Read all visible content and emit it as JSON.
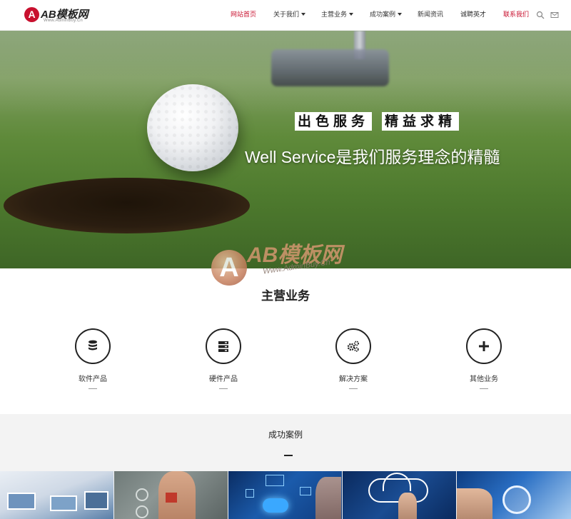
{
  "header": {
    "logo_text": "AB模板网",
    "logo_badge": "A",
    "logo_sub": "Www.AdminBuy.Cn",
    "nav": [
      {
        "label": "网站首页",
        "has_caret": false,
        "active": true
      },
      {
        "label": "关于我们",
        "has_caret": true,
        "active": false
      },
      {
        "label": "主营业务",
        "has_caret": true,
        "active": false
      },
      {
        "label": "成功案例",
        "has_caret": true,
        "active": false
      },
      {
        "label": "新闻资讯",
        "has_caret": false,
        "active": false
      },
      {
        "label": "诚聘英才",
        "has_caret": false,
        "active": false
      },
      {
        "label": "联系我们",
        "has_caret": false,
        "active": false
      }
    ],
    "icons": [
      "search-icon",
      "mail-icon"
    ]
  },
  "hero": {
    "tagline_1": "出色服务",
    "tagline_2": "精益求精",
    "subtitle": "Well Service是我们服务理念的精髓"
  },
  "watermark": {
    "badge": "A",
    "text": "AB模板网",
    "sub": "Www.AdminBuy.Cn"
  },
  "services": {
    "title": "主营业务",
    "items": [
      {
        "label": "软件产品",
        "icon": "database-icon"
      },
      {
        "label": "硬件产品",
        "icon": "server-icon"
      },
      {
        "label": "解决方案",
        "icon": "gears-icon"
      },
      {
        "label": "其他业务",
        "icon": "plus-icon"
      }
    ]
  },
  "cases": {
    "title": "成功案例"
  },
  "colors": {
    "accent": "#c8102e",
    "text": "#222222",
    "cases_bg": "#f3f3f3"
  }
}
